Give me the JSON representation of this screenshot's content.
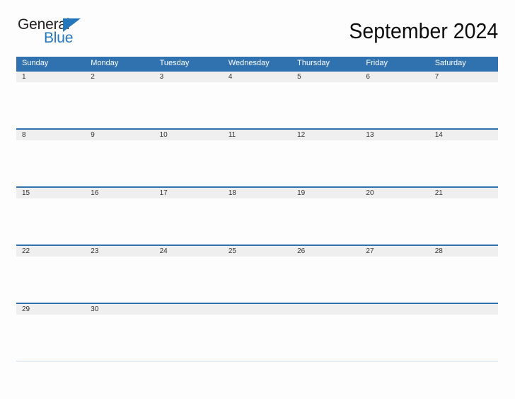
{
  "logo": {
    "word_one": "General",
    "word_two": "Blue",
    "triangle_icon": "triangle-icon",
    "brand_blue": "#2476bd",
    "brand_dark": "#231f20"
  },
  "header": {
    "title": "September 2024",
    "month": "September",
    "year": "2024"
  },
  "calendar": {
    "header_bg": "#3071b0",
    "header_text_color": "#ffffff",
    "date_strip_bg": "#efefef",
    "date_text_color": "#333333",
    "weekdays": [
      "Sunday",
      "Monday",
      "Tuesday",
      "Wednesday",
      "Thursday",
      "Friday",
      "Saturday"
    ],
    "weeks": [
      {
        "dates": [
          "1",
          "2",
          "3",
          "4",
          "5",
          "6",
          "7"
        ]
      },
      {
        "dates": [
          "8",
          "9",
          "10",
          "11",
          "12",
          "13",
          "14"
        ]
      },
      {
        "dates": [
          "15",
          "16",
          "17",
          "18",
          "19",
          "20",
          "21"
        ]
      },
      {
        "dates": [
          "22",
          "23",
          "24",
          "25",
          "26",
          "27",
          "28"
        ]
      },
      {
        "dates": [
          "29",
          "30",
          "",
          "",
          "",
          "",
          ""
        ]
      }
    ]
  }
}
